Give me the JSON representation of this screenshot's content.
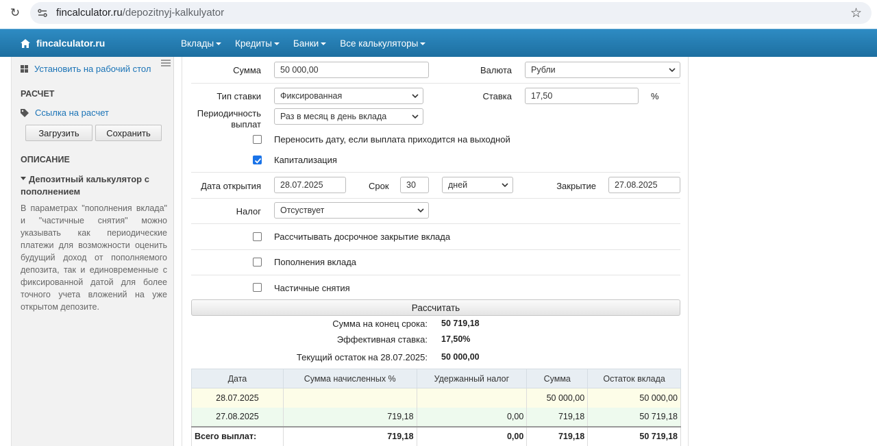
{
  "browser": {
    "url_domain": "fincalculator.ru",
    "url_path": "/depozitnyj-kalkulyator",
    "icons": [
      "reload-icon",
      "site-info-icon",
      "star-icon"
    ]
  },
  "nav": {
    "brand": "fincalculator.ru",
    "items": [
      "Вклады",
      "Кредиты",
      "Банки",
      "Все калькуляторы"
    ],
    "color": "#2a84bb"
  },
  "sidebar": {
    "install_link": "Установить на рабочий стол",
    "calc_heading": "РАСЧЕТ",
    "calc_link": "Ссылка на расчет",
    "load_button": "Загрузить",
    "save_button": "Сохранить",
    "desc_heading": "ОПИСАНИЕ",
    "desc_title": "Депозитный калькулятор с пополнением",
    "desc_text": "В параметрах \"пополнения вклада\" и \"частичные снятия\" можно указывать как периодические платежи для возможности оценить будущий доход от пополняемого депозита, так и единовременные с фиксированной датой для более точного учета вложений на уже открытом депозите."
  },
  "form": {
    "amount_label": "Сумма",
    "amount_value": "50 000,00",
    "currency_label": "Валюта",
    "currency_value": "Рубли",
    "rate_type_label": "Тип ставки",
    "rate_type_value": "Фиксированная",
    "rate_label": "Ставка",
    "rate_value": "17,50",
    "rate_unit": "%",
    "periodicity_label_1": "Периодичность",
    "periodicity_label_2": "выплат",
    "periodicity_value": "Раз в месяц в день вклада",
    "move_date_label": "Переносить дату, если выплата приходится на выходной",
    "move_date_checked": false,
    "capitalization_label": "Капитализация",
    "capitalization_checked": true,
    "open_date_label": "Дата открытия",
    "open_date_value": "28.07.2025",
    "term_label": "Срок",
    "term_value": "30",
    "term_unit_value": "дней",
    "close_label": "Закрытие",
    "close_value": "27.08.2025",
    "tax_label": "Налог",
    "tax_value": "Отсуствует",
    "early_close_label": "Рассчитывать досрочное закрытие вклада",
    "replenish_label": "Пополнения вклада",
    "withdraw_label": "Частичные снятия",
    "calc_button": "Рассчитать"
  },
  "results": {
    "end_sum_label": "Сумма на конец срока:",
    "end_sum_value": "50 719,18",
    "eff_rate_label": "Эффективная ставка:",
    "eff_rate_value": "17,50%",
    "balance_label": "Текущий остаток на 28.07.2025:",
    "balance_value": "50 000,00"
  },
  "table": {
    "headers": [
      "Дата",
      "Сумма начисленных %",
      "Удержанный налог",
      "Сумма",
      "Остаток вклада"
    ],
    "rows": [
      [
        "28.07.2025",
        "",
        "",
        "50 000,00",
        "50 000,00"
      ],
      [
        "27.08.2025",
        "719,18",
        "0,00",
        "719,18",
        "50 719,18"
      ]
    ],
    "total": [
      "Всего выплат:",
      "719,18",
      "0,00",
      "719,18",
      "50 719,18"
    ]
  }
}
